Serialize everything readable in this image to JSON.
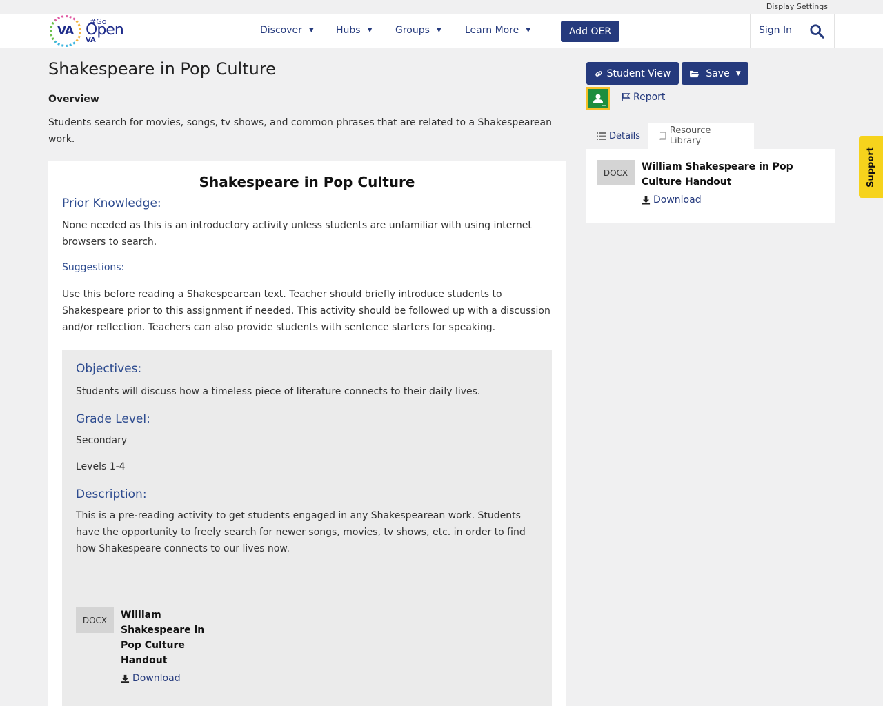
{
  "topbar": {
    "display_settings": "Display Settings"
  },
  "nav": {
    "logo_go": "#Go",
    "logo_open": "Open",
    "logo_va": "VA",
    "items": [
      {
        "label": "Discover"
      },
      {
        "label": "Hubs"
      },
      {
        "label": "Groups"
      },
      {
        "label": "Learn More"
      }
    ],
    "add_oer": "Add OER",
    "sign_in": "Sign In"
  },
  "page": {
    "title": "Shakespeare in Pop Culture",
    "overview_heading": "Overview",
    "overview_text": "Students search for movies, songs, tv shows, and common phrases that are related to a Shakespearean work."
  },
  "content": {
    "title": "Shakespeare in Pop Culture",
    "prior_knowledge_heading": "Prior Knowledge:",
    "prior_knowledge_text": "None needed as this is an introductory activity unless students are unfamiliar with using internet browsers to search.",
    "suggestions_heading": "Suggestions:",
    "suggestions_text": "Use this before reading a Shakespearean text. Teacher should briefly introduce students to Shakespeare prior to this assignment if needed. This activity should be followed up with a discussion and/or reflection. Teachers can also provide students with sentence starters for speaking.",
    "objectives_heading": "Objectives:",
    "objectives_text": "Students will discuss how a timeless piece of literature connects to their daily lives.",
    "grade_heading": "Grade Level:",
    "grade_text": "Secondary",
    "levels_text": "Levels 1-4",
    "description_heading": "Description:",
    "description_text": "This is a pre-reading activity to get students engaged in any Shakespearean work. Students have the opportunity to freely search for newer songs, movies, tv shows, etc. in order to find how Shakespeare connects to our lives now.",
    "attachment": {
      "type": "DOCX",
      "title": "William Shakespeare in Pop Culture Handout",
      "download": "Download"
    }
  },
  "sidebar": {
    "student_view": "Student View",
    "save": "Save",
    "report": "Report",
    "tabs": [
      {
        "label": "Details"
      },
      {
        "label": "Resource Library"
      }
    ],
    "file": {
      "type": "DOCX",
      "title": "William Shakespeare in Pop Culture Handout",
      "download": "Download"
    }
  },
  "support": "Support",
  "colors": {
    "primary": "#253a7d",
    "heading": "#2d4b8f",
    "support": "#f6d31c",
    "classroom_border": "#f6c026"
  }
}
